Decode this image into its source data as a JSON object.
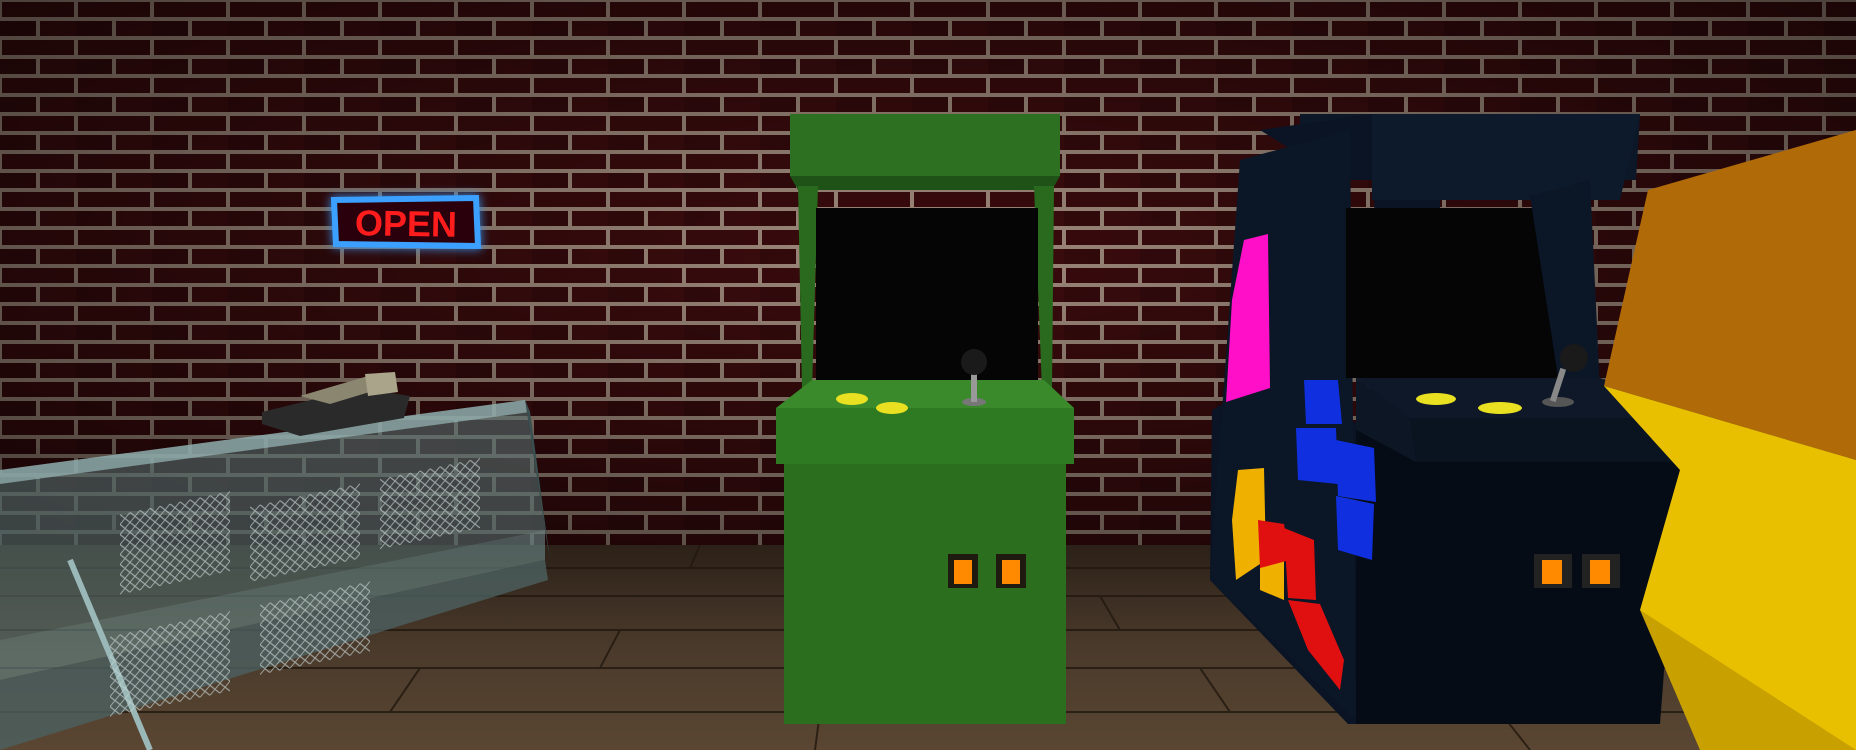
{
  "scene": {
    "sign": {
      "text": "OPEN",
      "text_color": "#ff1a1a",
      "border_color": "#3aa0ff"
    },
    "wall": {
      "mortar_color": "#b09a8a",
      "brick_color": "#3a0a0c"
    },
    "floor": {
      "color": "#4a3a2c"
    },
    "green_cabinet": {
      "color": "#2e7a22",
      "button_color": "#e8e020",
      "coin_slot_color": "#ff8a00"
    },
    "dark_cabinet": {
      "color": "#0a1220",
      "decal_colors": [
        "#ff10c8",
        "#1030e0",
        "#f0b000",
        "#e01010"
      ],
      "button_color": "#e8e020",
      "coin_slot_color": "#ff8a00"
    },
    "counter": {
      "glass_color": "#6a8a8a"
    }
  }
}
